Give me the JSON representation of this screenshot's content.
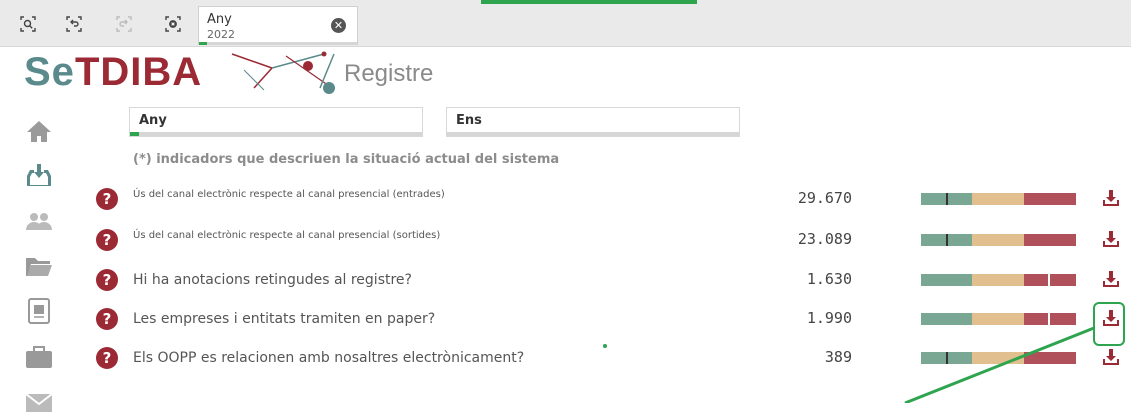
{
  "toolbar": {
    "buttons": [
      {
        "name": "smart-search-icon"
      },
      {
        "name": "step-back-icon"
      },
      {
        "name": "step-forward-icon"
      },
      {
        "name": "clear-selections-icon"
      }
    ],
    "selection_chip": {
      "title": "Any",
      "value": "2022"
    }
  },
  "logo": {
    "text": "SeTDIBA",
    "subtitle": "Registre",
    "colors": {
      "se": "#5a8a8c",
      "tdiba": "#9b2a35"
    }
  },
  "sidebar": [
    "home-icon",
    "inbox-download-icon",
    "users-icon",
    "folder-icon",
    "document-icon",
    "briefcase-icon",
    "mail-icon"
  ],
  "filters": [
    {
      "label": "Any"
    },
    {
      "label": "Ens"
    }
  ],
  "note": "(*) indicadors que descriuen la situació actual del sistema",
  "indicators": [
    {
      "label": "Ús del canal electrònic respecte al canal presencial (entrades)",
      "value": "29.670",
      "marker": 0.16,
      "size": "small"
    },
    {
      "label": "Ús del canal electrònic respecte al canal presencial (sortides)",
      "value": "23.089",
      "marker": 0.16,
      "size": "small"
    },
    {
      "label": "Hi ha anotacions retingudes al registre?",
      "value": "1.630",
      "marker": 0.82,
      "size": "big"
    },
    {
      "label": "Les empreses i entitats tramiten en paper?",
      "value": "1.990",
      "marker": 0.82,
      "size": "big"
    },
    {
      "label": "Els OOPP es relacionen amb nosaltres electrònicament?",
      "value": "389",
      "marker": 0.16,
      "size": "big"
    }
  ],
  "gauge_colors": {
    "green": "#7aa793",
    "tan": "#e2bf8e",
    "red": "#b0505a",
    "marker": "#333333"
  },
  "accent": "#2ea44f",
  "download_color": "#9b2a35"
}
